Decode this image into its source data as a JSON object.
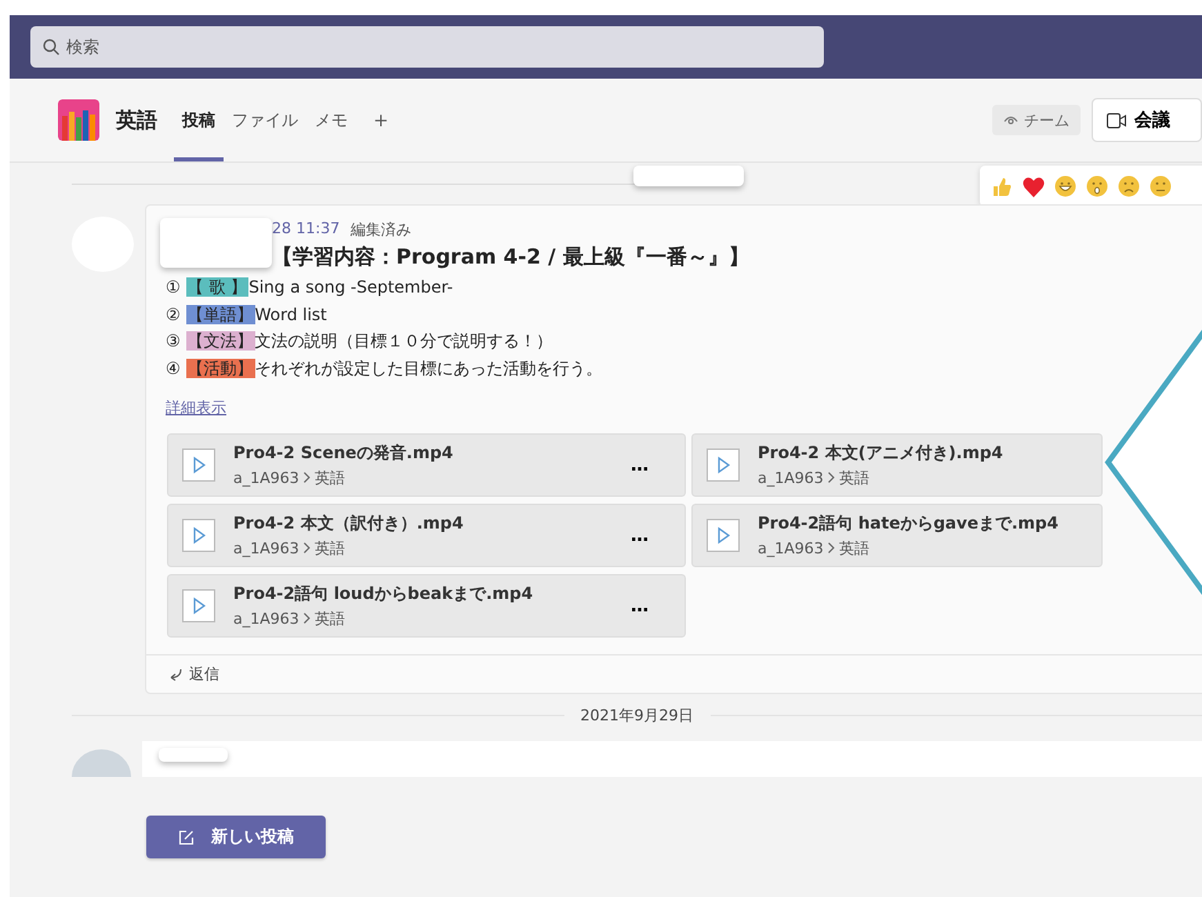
{
  "search": {
    "placeholder": "検索"
  },
  "channel": {
    "name": "英語",
    "tabs": [
      {
        "label": "投稿",
        "selected": true
      },
      {
        "label": "ファイル",
        "selected": false
      },
      {
        "label": "メモ",
        "selected": false
      }
    ],
    "add_tab": "＋",
    "team_button": "チーム",
    "meet_button": "会議"
  },
  "post": {
    "time": "28 11:37",
    "edited": "編集済み",
    "title": "【学習内容：Program 4-2 / 最上級『一番～』】",
    "lines": [
      {
        "number": "①",
        "tag": "【 歌 】",
        "color": "#5bbdbd",
        "text": "Sing a song -September-"
      },
      {
        "number": "②",
        "tag": "【単語】",
        "color": "#6f8fd2",
        "text": "Word list"
      },
      {
        "number": "③",
        "tag": "【文法】",
        "color": "#dcb0cf",
        "text": "文法の説明（目標１０分で説明する！）"
      },
      {
        "number": "④",
        "tag": "【活動】",
        "color": "#e9704f",
        "text": "それぞれが設定した目標にあった活動を行う。"
      }
    ],
    "show_more": "詳細表示",
    "attachments": [
      {
        "name": "Pro4-2 Sceneの発音.mp4",
        "path": "a_1A963",
        "folder": "英語",
        "more": "…"
      },
      {
        "name": "Pro4-2 本文(アニメ付き).mp4",
        "path": "a_1A963",
        "folder": "英語"
      },
      {
        "name": "Pro4-2 本文（訳付き）.mp4",
        "path": "a_1A963",
        "folder": "英語",
        "more": "…"
      },
      {
        "name": "Pro4-2語句 hateからgaveまで.mp4",
        "path": "a_1A963",
        "folder": "英語"
      },
      {
        "name": "Pro4-2語句 loudからbeakまで.mp4",
        "path": "a_1A963",
        "folder": "英語",
        "more": "…"
      }
    ],
    "reply": "返信"
  },
  "date_divider": "2021年9月29日",
  "new_post_button": "新しい投稿"
}
